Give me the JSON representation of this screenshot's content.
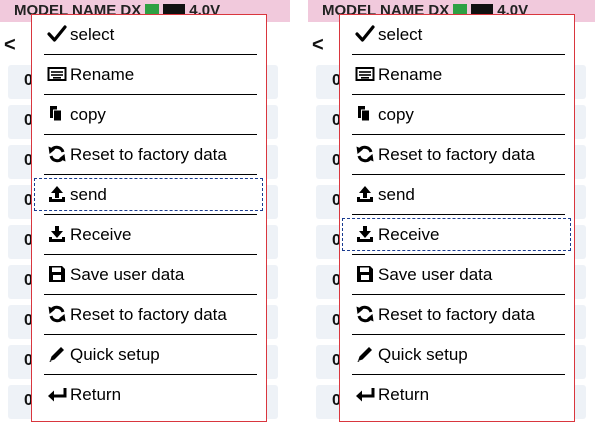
{
  "panels": [
    {
      "header": {
        "title": "MODEL NAME DX",
        "voltage": "4.0V"
      },
      "back_label": "<",
      "row_digits": [
        "0",
        "0",
        "0",
        "0",
        "0",
        "0",
        "0",
        "0",
        "0"
      ],
      "menu": {
        "items": [
          {
            "label": "select",
            "icon": "check-icon"
          },
          {
            "label": "Rename",
            "icon": "keyboard-icon"
          },
          {
            "label": "copy",
            "icon": "copy-icon"
          },
          {
            "label": "Reset to factory data",
            "icon": "refresh-icon"
          },
          {
            "label": "send",
            "icon": "upload-icon"
          },
          {
            "label": "Receive",
            "icon": "download-icon"
          },
          {
            "label": "Save user data",
            "icon": "save-icon"
          },
          {
            "label": "Reset to factory data",
            "icon": "refresh-icon"
          },
          {
            "label": "Quick setup",
            "icon": "pencil-icon"
          },
          {
            "label": "Return",
            "icon": "return-arrow-icon"
          }
        ],
        "focused_index": 4
      }
    },
    {
      "header": {
        "title": "MODEL NAME DX",
        "voltage": "4.0V"
      },
      "back_label": "<",
      "row_digits": [
        "0",
        "0",
        "0",
        "0",
        "0",
        "0",
        "0",
        "0",
        "0"
      ],
      "menu": {
        "items": [
          {
            "label": "select",
            "icon": "check-icon"
          },
          {
            "label": "Rename",
            "icon": "keyboard-icon"
          },
          {
            "label": "copy",
            "icon": "copy-icon"
          },
          {
            "label": "Reset to factory data",
            "icon": "refresh-icon"
          },
          {
            "label": "send",
            "icon": "upload-icon"
          },
          {
            "label": "Receive",
            "icon": "download-icon"
          },
          {
            "label": "Save user data",
            "icon": "save-icon"
          },
          {
            "label": "Reset to factory data",
            "icon": "refresh-icon"
          },
          {
            "label": "Quick setup",
            "icon": "pencil-icon"
          },
          {
            "label": "Return",
            "icon": "return-arrow-icon"
          }
        ],
        "focused_index": 5
      }
    }
  ],
  "colors": {
    "header_bg": "#f1c9dc",
    "menu_border": "#d9363e",
    "focus_border": "#1a3b8f",
    "row_bg": "#eef2f7",
    "battery_green": "#2ea043"
  }
}
